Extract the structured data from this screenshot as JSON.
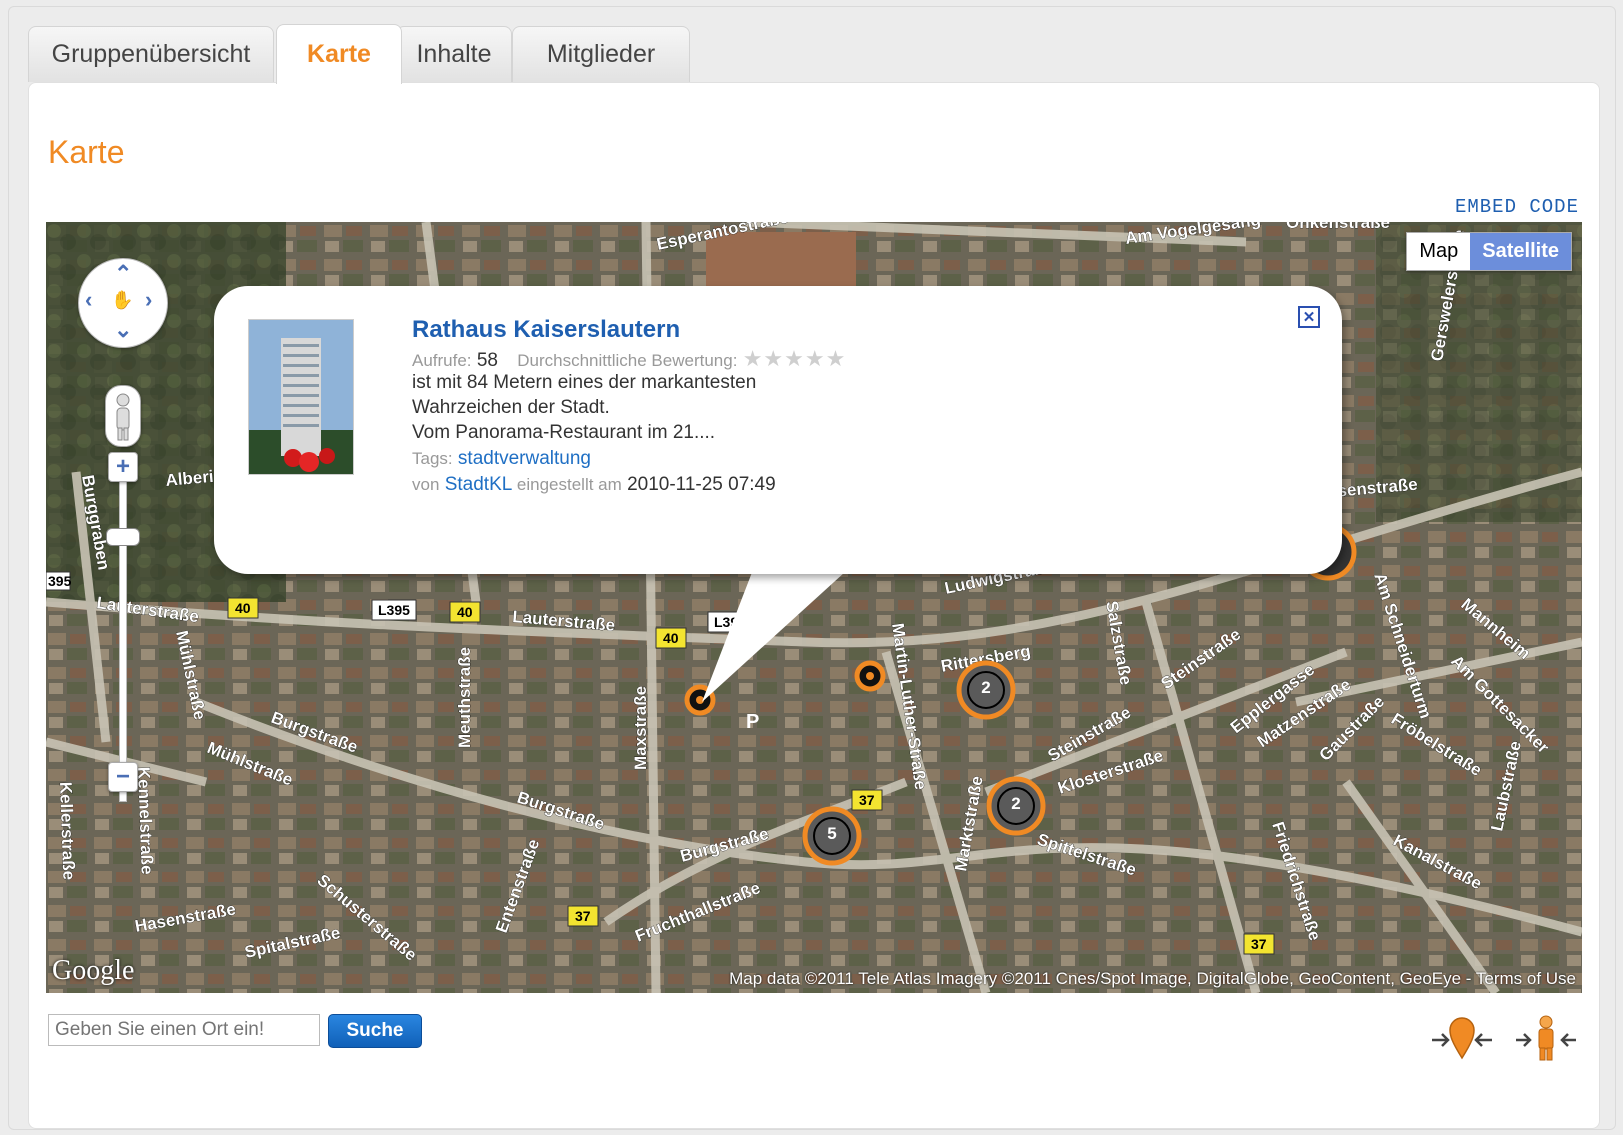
{
  "tabs": [
    {
      "label": "Gruppenübersicht",
      "active": false
    },
    {
      "label": "Karte",
      "active": true
    },
    {
      "label": "Inhalte",
      "active": false
    },
    {
      "label": "Mitglieder",
      "active": false
    }
  ],
  "page_title": "Karte",
  "embed_code": "EMBED CODE",
  "map": {
    "type_buttons": {
      "map": "Map",
      "satellite": "Satellite"
    },
    "active_type": "Satellite",
    "streets": [
      "Esperantostraße",
      "Am Vogelgesang",
      "Onkenstraße",
      "Lauterstraße",
      "L395",
      "Ludwigstraße",
      "Burgstraße",
      "Maxstraße",
      "Meuthstraße",
      "Mühlstraße",
      "Kennelstraße",
      "Kellerstraße",
      "Hasenstraße",
      "Spitalstraße",
      "Schusterstraße",
      "Entenstraße",
      "Fruchthallstraße",
      "Martin-Luther-Straße",
      "Rittersberg",
      "Salzstraße",
      "Steinstraße",
      "Klosterstraße",
      "Spittelstraße",
      "Epplergasse",
      "Matzenstraße",
      "Gaustraße",
      "Fröbelstraße",
      "Kanalstraße",
      "Friedrichstraße",
      "Marktstraße",
      "Mannheim",
      "Am Gottesacker",
      "Laubstraße",
      "Burggraben",
      "Alberichstraße",
      "Gerswelerstraße"
    ],
    "road_badges": [
      "40",
      "40",
      "40",
      "37",
      "37",
      "37",
      "395"
    ],
    "clusters": [
      {
        "count": "2"
      },
      {
        "count": "2"
      },
      {
        "count": "5"
      }
    ],
    "google_logo": "Google",
    "copyright": "Map data ©2011 Tele Atlas Imagery ©2011 Cnes/Spot Image, DigitalGlobe, GeoContent, GeoEye - Terms of Use"
  },
  "infowindow": {
    "title": "Rathaus Kaiserslautern",
    "views_label": "Aufrufe:",
    "views_value": "58",
    "rating_label": "Durchschnittliche Bewertung:",
    "rating_stars": "★★★★★",
    "rating_value": 0,
    "description_lines": [
      "ist mit 84 Metern eines der markantesten",
      "Wahrzeichen der Stadt.",
      "Vom Panorama-Restaurant im 21...."
    ],
    "tags_label": "Tags:",
    "tag": "stadtverwaltung",
    "by_label": "von",
    "author": "StadtKL",
    "posted_label": "eingestellt am",
    "posted_date": "2010-11-25 07:49",
    "close_symbol": "✕"
  },
  "search": {
    "placeholder": "Geben Sie einen Ort ein!",
    "button_label": "Suche"
  },
  "colors": {
    "accent": "#f08a24",
    "link": "#1f5fb0",
    "cluster_ring": "#f08a24",
    "button": "#1a6fcc"
  }
}
